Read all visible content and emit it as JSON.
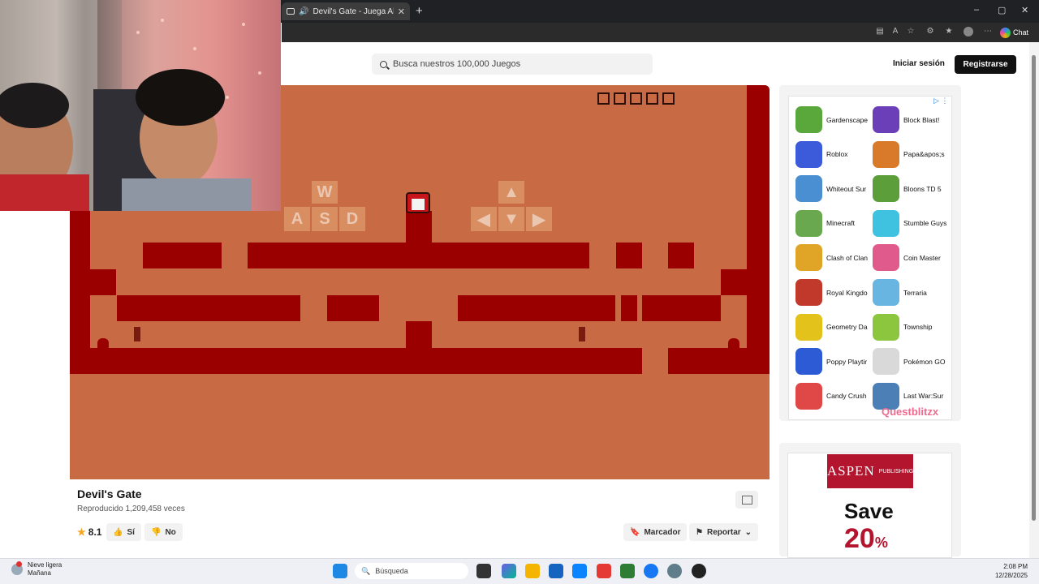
{
  "browser": {
    "tab_title": "Devil's Gate - Juega Ahora en",
    "new_tab": "+",
    "window_controls": [
      "–",
      "▢",
      "✕"
    ],
    "chat_label": "Chat",
    "toolbar_icons": [
      "reader-icon",
      "read-aloud-icon",
      "favorite-icon",
      "extensions-icon",
      "favorites-bar-icon",
      "profile-icon",
      "menu-icon"
    ]
  },
  "header": {
    "search_placeholder": "Busca nuestros 100,000 Juegos",
    "login": "Iniciar sesión",
    "register": "Registrarse"
  },
  "game": {
    "controls_letters": [
      "W",
      "A",
      "S",
      "D"
    ],
    "lives_boxes": 5,
    "title": "Devil's Gate",
    "plays": "Reproducido 1,209,458 veces",
    "rating": "8.1",
    "yes": "Sí",
    "no": "No",
    "bookmark": "Marcador",
    "report": "Reportar"
  },
  "ads": {
    "choices": "▷ ⋮",
    "games": [
      {
        "name": "Gardenscape",
        "color": "#5aa83c"
      },
      {
        "name": "Block Blast!",
        "color": "#6b3fb8"
      },
      {
        "name": "Roblox",
        "color": "#3b5bdb"
      },
      {
        "name": "Papa&apos;s",
        "color": "#d97a2b"
      },
      {
        "name": "Whiteout Sur",
        "color": "#4a8fd1"
      },
      {
        "name": "Bloons TD 5",
        "color": "#5c9e3a"
      },
      {
        "name": "Minecraft",
        "color": "#6aa84f"
      },
      {
        "name": "Stumble Guys",
        "color": "#3fc1e0"
      },
      {
        "name": "Clash of Clan",
        "color": "#e0a526"
      },
      {
        "name": "Coin Master",
        "color": "#e05a8b"
      },
      {
        "name": "Royal Kingdo",
        "color": "#c0392b"
      },
      {
        "name": "Terraria",
        "color": "#67b5e0"
      },
      {
        "name": "Geometry Da",
        "color": "#e2c21b"
      },
      {
        "name": "Township",
        "color": "#8cc63f"
      },
      {
        "name": "Poppy Playtir",
        "color": "#2d5bd6"
      },
      {
        "name": "Pokémon GO",
        "color": "#d9d9d9"
      },
      {
        "name": "Candy Crush",
        "color": "#e04848"
      },
      {
        "name": "Last War:Sur",
        "color": "#4c7fb5"
      }
    ],
    "brand": "Questblitzx",
    "aspen_name": "ASPEN",
    "aspen_sub": "PUBLISHING",
    "aspen_save": "Save",
    "aspen_pct": "20",
    "aspen_pct_sign": "%"
  },
  "taskbar": {
    "weather_line1": "Nieve ligera",
    "weather_line2": "Mañana",
    "search": "Búsqueda",
    "time": "2:08 PM",
    "date": "12/28/2025"
  },
  "colors": {
    "game_bg": "#c86b45",
    "wall": "#9a0000",
    "accent_red": "#b3142e"
  }
}
